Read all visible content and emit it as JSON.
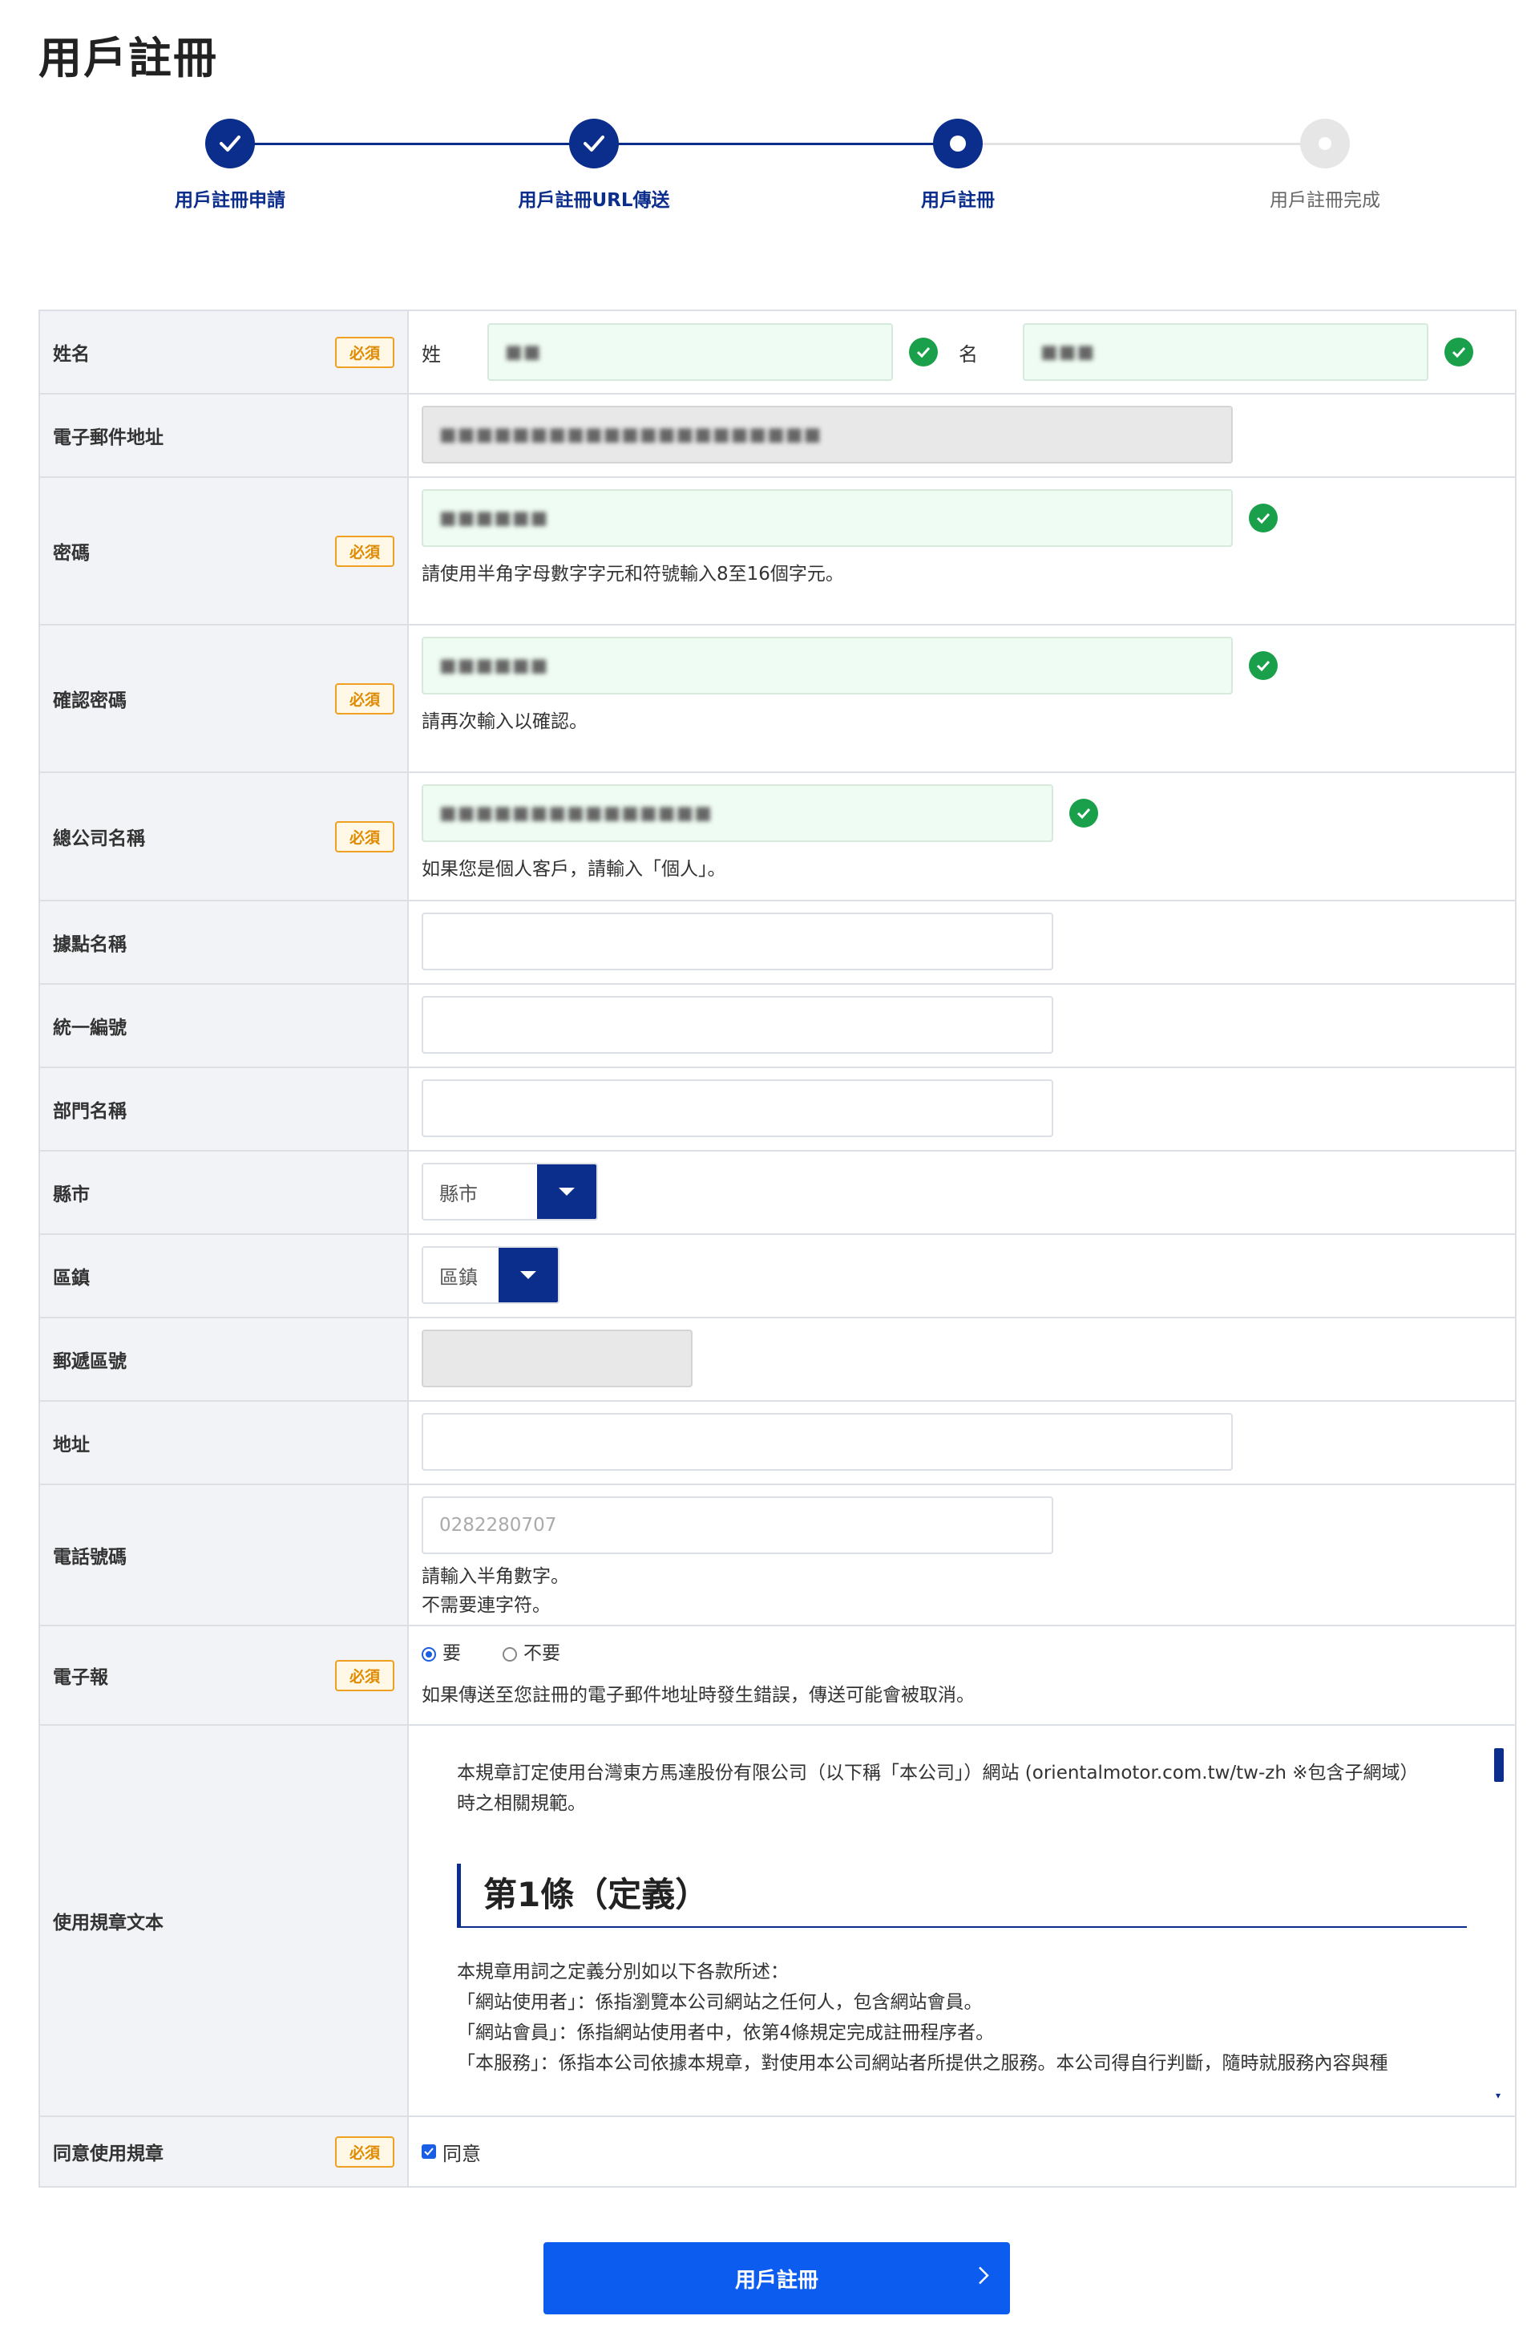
{
  "page": {
    "title": "用戶註冊"
  },
  "stepper": {
    "steps": [
      {
        "label": "用戶註冊申請",
        "state": "done"
      },
      {
        "label": "用戶註冊URL傳送",
        "state": "done"
      },
      {
        "label": "用戶註冊",
        "state": "current"
      },
      {
        "label": "用戶註冊完成",
        "state": "pending"
      }
    ]
  },
  "required_label": "必須",
  "form": {
    "name": {
      "label": "姓名",
      "surname_label": "姓",
      "surname_value": "■■",
      "given_label": "名",
      "given_value": "■■■"
    },
    "email": {
      "label": "電子郵件地址",
      "value": "■■■■■■■■■■■■■■■■■■■■■"
    },
    "password": {
      "label": "密碼",
      "value": "■■■■■■",
      "hint": "請使用半角字母數字字元和符號輸入8至16個字元。"
    },
    "password_confirm": {
      "label": "確認密碼",
      "value": "■■■■■■",
      "hint": "請再次輸入以確認。"
    },
    "company": {
      "label": "總公司名稱",
      "value": "■■■■■■■■■■■■■■■",
      "hint": "如果您是個人客戶，請輸入「個人」。"
    },
    "branch": {
      "label": "據點名稱",
      "value": ""
    },
    "tax_id": {
      "label": "統一編號",
      "value": ""
    },
    "department": {
      "label": "部門名稱",
      "value": ""
    },
    "city": {
      "label": "縣市",
      "selected": "縣市"
    },
    "district": {
      "label": "區鎮",
      "selected": "區鎮"
    },
    "postal": {
      "label": "郵遞區號",
      "value": ""
    },
    "address": {
      "label": "地址",
      "value": ""
    },
    "phone": {
      "label": "電話號碼",
      "placeholder": "0282280707",
      "hint1": "請輸入半角數字。",
      "hint2": "不需要連字符。"
    },
    "newsletter": {
      "label": "電子報",
      "option_yes": "要",
      "option_no": "不要",
      "selected": "要",
      "hint": "如果傳送至您註冊的電子郵件地址時發生錯誤，傳送可能會被取消。"
    },
    "terms": {
      "label": "使用規章文本",
      "intro_line1": "本規章訂定使用台灣東方馬達股份有限公司（以下稱「本公司」）網站 (orientalmotor.com.tw/tw-zh ※包含子網域）",
      "intro_line2": "時之相關規範。",
      "heading": "第1條（定義）",
      "lines": [
        "本規章用詞之定義分別如以下各款所述：",
        "「網站使用者」：係指瀏覽本公司網站之任何人，包含網站會員。",
        "「網站會員」：係指網站使用者中，依第4條規定完成註冊程序者。",
        "「本服務」：係指本公司依據本規章，對使用本公司網站者所提供之服務。本公司得自行判斷，隨時就服務內容與種"
      ]
    },
    "agree": {
      "label": "同意使用規章",
      "checkbox_label": "同意",
      "checked": true
    }
  },
  "submit": {
    "label": "用戶註冊"
  },
  "colors": {
    "primary": "#0b2d8c",
    "button": "#0d5cf0",
    "success": "#1aa04a",
    "required": "#e08a00"
  }
}
